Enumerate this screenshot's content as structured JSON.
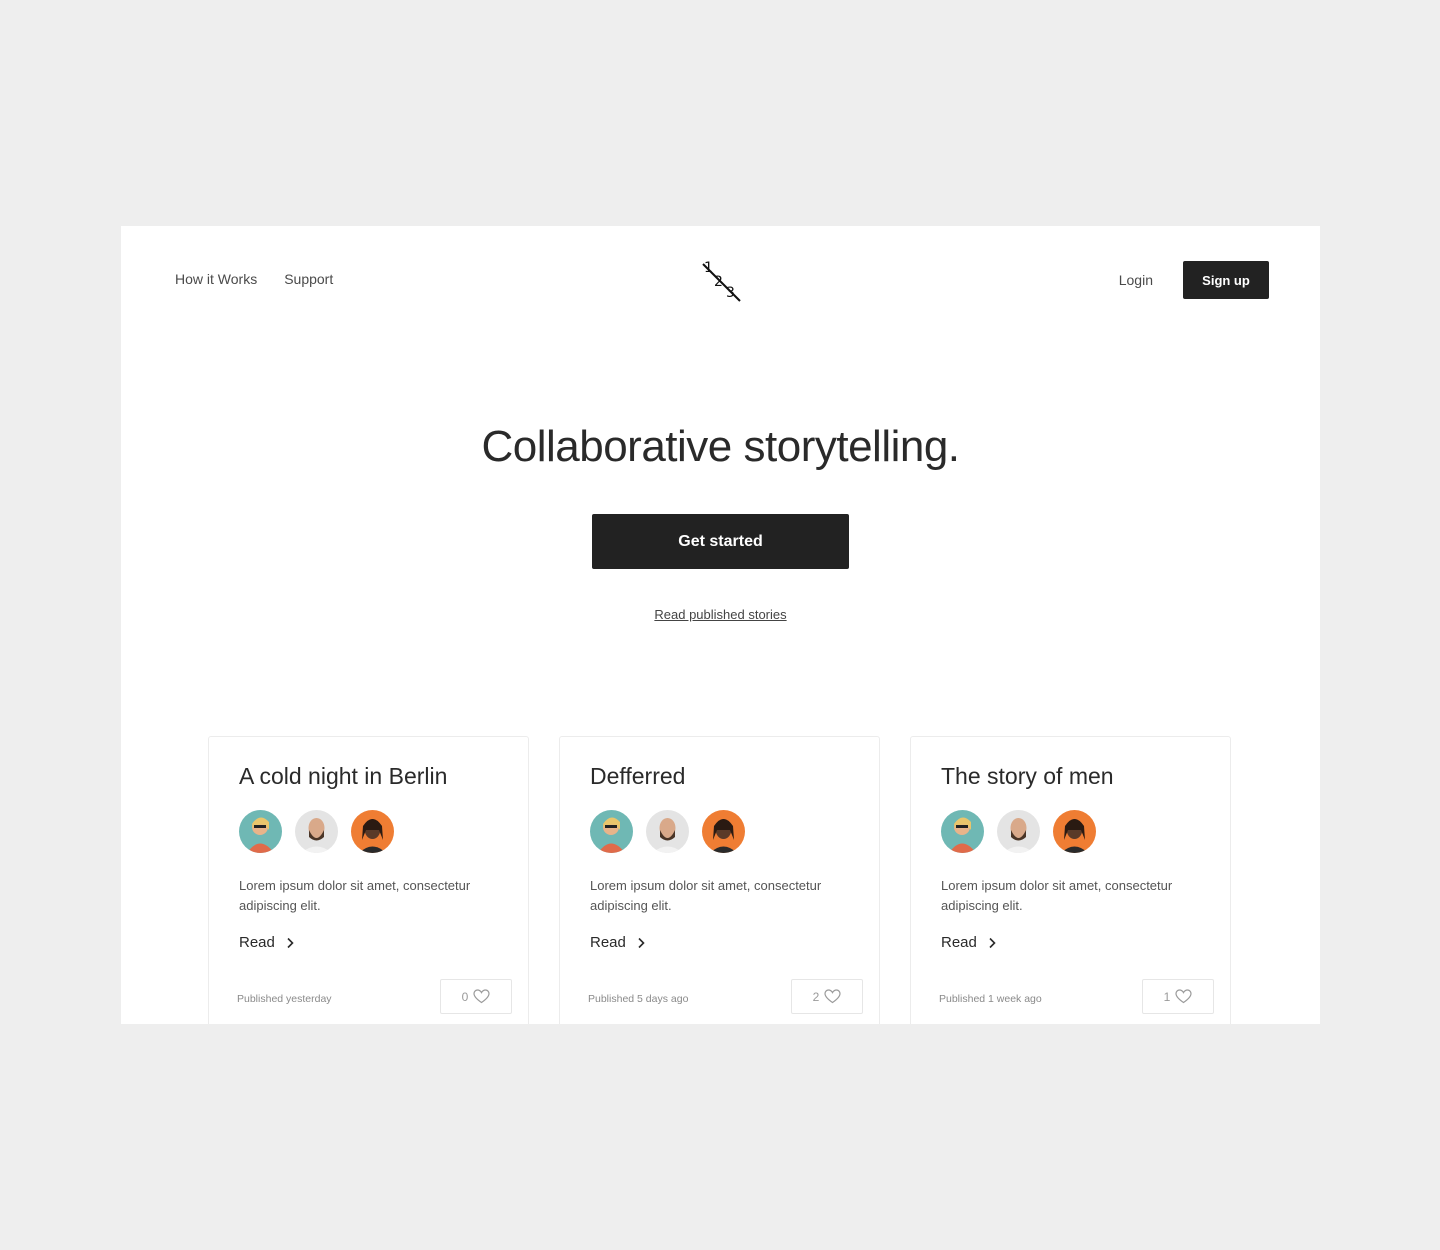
{
  "nav": {
    "links": [
      "How it Works",
      "Support"
    ],
    "login": "Login",
    "signup": "Sign up"
  },
  "logo": {
    "icon": "logo-123-icon",
    "digits": [
      "1",
      "2",
      "3"
    ]
  },
  "hero": {
    "title": "Collaborative storytelling.",
    "cta": "Get started",
    "secondary_link": "Read published stories"
  },
  "cards": [
    {
      "title": "A cold night in Berlin",
      "description": "Lorem ipsum dolor sit amet, consectetur adipiscing elit.",
      "read_label": "Read",
      "published": "Published yesterday",
      "likes": "0"
    },
    {
      "title": "Defferred",
      "description": "Lorem ipsum dolor sit amet, consectetur adipiscing elit.",
      "read_label": "Read",
      "published": "Published 5 days ago",
      "likes": "2"
    },
    {
      "title": "The story of men",
      "description": "Lorem ipsum dolor sit amet, consectetur adipiscing elit.",
      "read_label": "Read",
      "published": "Published 1 week ago",
      "likes": "1"
    }
  ],
  "colors": {
    "page_bg": "#eeeeee",
    "frame_bg": "#ffffff",
    "button_dark": "#222222",
    "text_dark": "#2a2a2a",
    "muted_text": "#8a8a8a",
    "avatar_teal": "#6fb8b4",
    "avatar_orange": "#ef7d33"
  }
}
